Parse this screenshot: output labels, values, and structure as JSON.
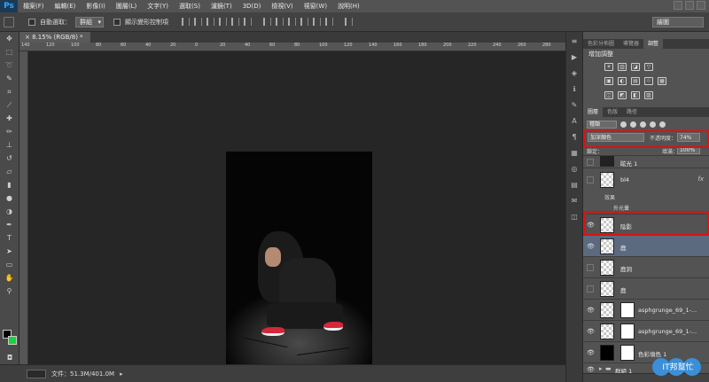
{
  "app": {
    "logo": "Ps"
  },
  "menu": [
    "檔案(F)",
    "編輯(E)",
    "影像(I)",
    "圖層(L)",
    "文字(Y)",
    "選取(S)",
    "濾鏡(T)",
    "3D(D)",
    "檢視(V)",
    "視窗(W)",
    "說明(H)"
  ],
  "options": {
    "auto_select_label": "自動選取：",
    "auto_select_value": "群組",
    "show_transform_label": "顯示變形控制項"
  },
  "workspace": "繪圖",
  "document": {
    "tab_title": "8.15% (RGB/8) *"
  },
  "ruler_ticks": [
    "140",
    "120",
    "100",
    "80",
    "60",
    "40",
    "20",
    "0",
    "20",
    "40",
    "60",
    "80",
    "100",
    "120",
    "140",
    "160",
    "180",
    "200",
    "220",
    "240",
    "260",
    "280"
  ],
  "status": {
    "doc_size": "文件：51.3M/401.0M"
  },
  "panels": {
    "top_tabs": [
      "色彩分佈圖",
      "導覽器",
      "調整"
    ],
    "adjustments_title": "增加調整",
    "adj_row1": [
      "☀",
      "▥",
      "◪",
      "▽"
    ],
    "adj_row2": [
      "▣",
      "◐",
      "▤",
      "♲",
      "▦"
    ],
    "adj_row3": [
      "◫",
      "◩",
      "◧",
      "▨"
    ],
    "layer_tabs": [
      "圖層",
      "色版",
      "路徑"
    ],
    "kind_filter": "種類",
    "blend_mode": "加深顏色",
    "opacity_label": "不透明度：",
    "opacity_value": "74%",
    "lock_label": "鎖定：",
    "fill_label": "填滿：",
    "fill_value": "100%"
  },
  "layers": [
    {
      "name": "眩光 1",
      "visible": false
    },
    {
      "name": "bl4",
      "visible": false,
      "fx": "fx",
      "effects_label": "效果",
      "effect": "外光暈"
    },
    {
      "name": "陰影",
      "visible": true
    },
    {
      "name": "鹿",
      "visible": true,
      "selected": true
    },
    {
      "name": "鹿洞",
      "visible": false
    },
    {
      "name": "鹿",
      "visible": false
    },
    {
      "name": "asphgrunge_69_1-...",
      "visible": true
    },
    {
      "name": "asphgrunge_69_1-...",
      "visible": true
    },
    {
      "name": "色彩填色 1",
      "visible": true
    },
    {
      "name": "群組 1",
      "visible": true
    }
  ],
  "watermark": "IT邦幫忙",
  "colors": {
    "highlight": "#e01010",
    "selected_layer": "#5c6a80",
    "bg_swatch": "#19d33a"
  }
}
